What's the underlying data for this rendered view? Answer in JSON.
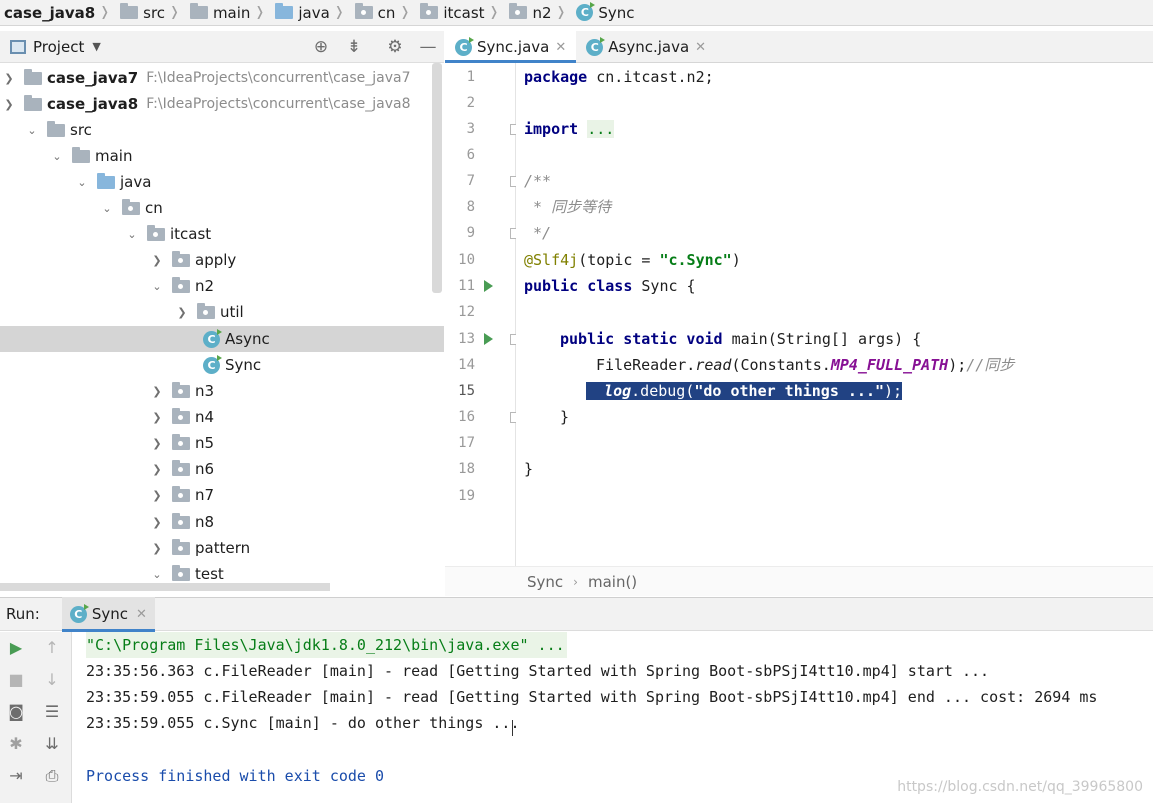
{
  "breadcrumb": [
    "case_java8",
    "src",
    "main",
    "java",
    "cn",
    "itcast",
    "n2",
    "Sync"
  ],
  "project": {
    "title": "Project",
    "tree": [
      {
        "label": "case_java7",
        "path": "F:\\IdeaProjects\\concurrent\\case_java7",
        "expanded": false
      },
      {
        "label": "case_java8",
        "path": "F:\\IdeaProjects\\concurrent\\case_java8",
        "expanded": true
      },
      {
        "label": "src",
        "expanded": true
      },
      {
        "label": "main",
        "expanded": true
      },
      {
        "label": "java",
        "expanded": true
      },
      {
        "label": "cn",
        "expanded": true
      },
      {
        "label": "itcast",
        "expanded": true
      },
      {
        "label": "apply",
        "expanded": false
      },
      {
        "label": "n2",
        "expanded": true
      },
      {
        "label": "util",
        "expanded": false
      },
      {
        "label": "Async",
        "selected": true
      },
      {
        "label": "Sync"
      },
      {
        "label": "n3",
        "expanded": false
      },
      {
        "label": "n4",
        "expanded": false
      },
      {
        "label": "n5",
        "expanded": false
      },
      {
        "label": "n6",
        "expanded": false
      },
      {
        "label": "n7",
        "expanded": false
      },
      {
        "label": "n8",
        "expanded": false
      },
      {
        "label": "pattern",
        "expanded": false
      },
      {
        "label": "test",
        "expanded": true
      }
    ]
  },
  "editor": {
    "tabs": [
      {
        "label": "Sync.java",
        "active": true
      },
      {
        "label": "Async.java",
        "active": false
      }
    ],
    "line_numbers": [
      "1",
      "2",
      "3",
      "6",
      "7",
      "8",
      "9",
      "10",
      "11",
      "12",
      "13",
      "14",
      "15",
      "16",
      "17",
      "18",
      "19"
    ],
    "code": {
      "l1_kw": "package",
      "l1_rest": " cn.itcast.n2;",
      "l3_kw": "import",
      "l3_fold": "...",
      "l7": "/**",
      "l8": " * 同步等待",
      "l9": " */",
      "l10_an": "@Slf4j",
      "l10_a": "(topic = ",
      "l10_str": "\"c.Sync\"",
      "l10_b": ")",
      "l11_kw": "public class",
      "l11_rest": " Sync {",
      "l13_kw": "public static void",
      "l13_rest": " main(String[] args) {",
      "l14_a": "FileReader.",
      "l14_read": "read",
      "l14_b": "(Constants.",
      "l14_const": "MP4_FULL_PATH",
      "l14_c": ");",
      "l14_cm": "//同步",
      "l15_log": "log",
      "l15_a": ".debug(",
      "l15_str": "\"do other things ...\"",
      "l15_b": ");",
      "l16": "}",
      "l18": "}"
    },
    "breadcrumb": [
      "Sync",
      "main()"
    ]
  },
  "run": {
    "label": "Run:",
    "tab": "Sync",
    "console": [
      "\"C:\\Program Files\\Java\\jdk1.8.0_212\\bin\\java.exe\" ...",
      "23:35:56.363 c.FileReader [main] - read [Getting Started with Spring Boot-sbPSjI4tt10.mp4] start ...",
      "23:35:59.055 c.FileReader [main] - read [Getting Started with Spring Boot-sbPSjI4tt10.mp4] end ... cost: 2694 ms",
      "23:35:59.055 c.Sync [main] - do other things ...",
      "",
      "Process finished with exit code 0"
    ]
  },
  "watermark": "https://blog.csdn.net/qq_39965800"
}
